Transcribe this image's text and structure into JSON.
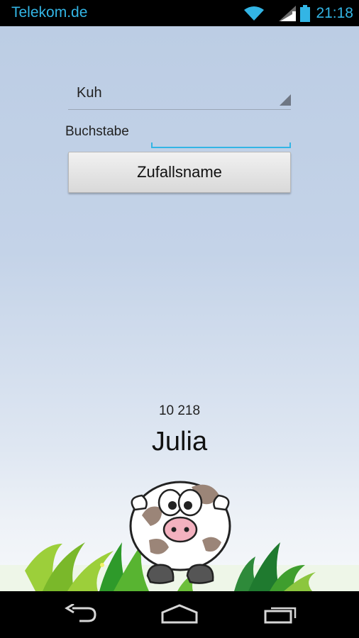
{
  "status_bar": {
    "carrier": "Telekom.de",
    "time": "21:18",
    "icons": [
      "wifi-icon",
      "signal-icon",
      "battery-icon"
    ],
    "accent_color": "#33b5e5"
  },
  "form": {
    "animal_selected": "Kuh",
    "letter_label": "Buchstabe",
    "letter_value": "",
    "random_button_label": "Zufallsname"
  },
  "result": {
    "count": "10 218",
    "name": "Julia"
  },
  "nav_bar": {
    "icons": [
      "back-icon",
      "home-icon",
      "recent-apps-icon"
    ]
  }
}
